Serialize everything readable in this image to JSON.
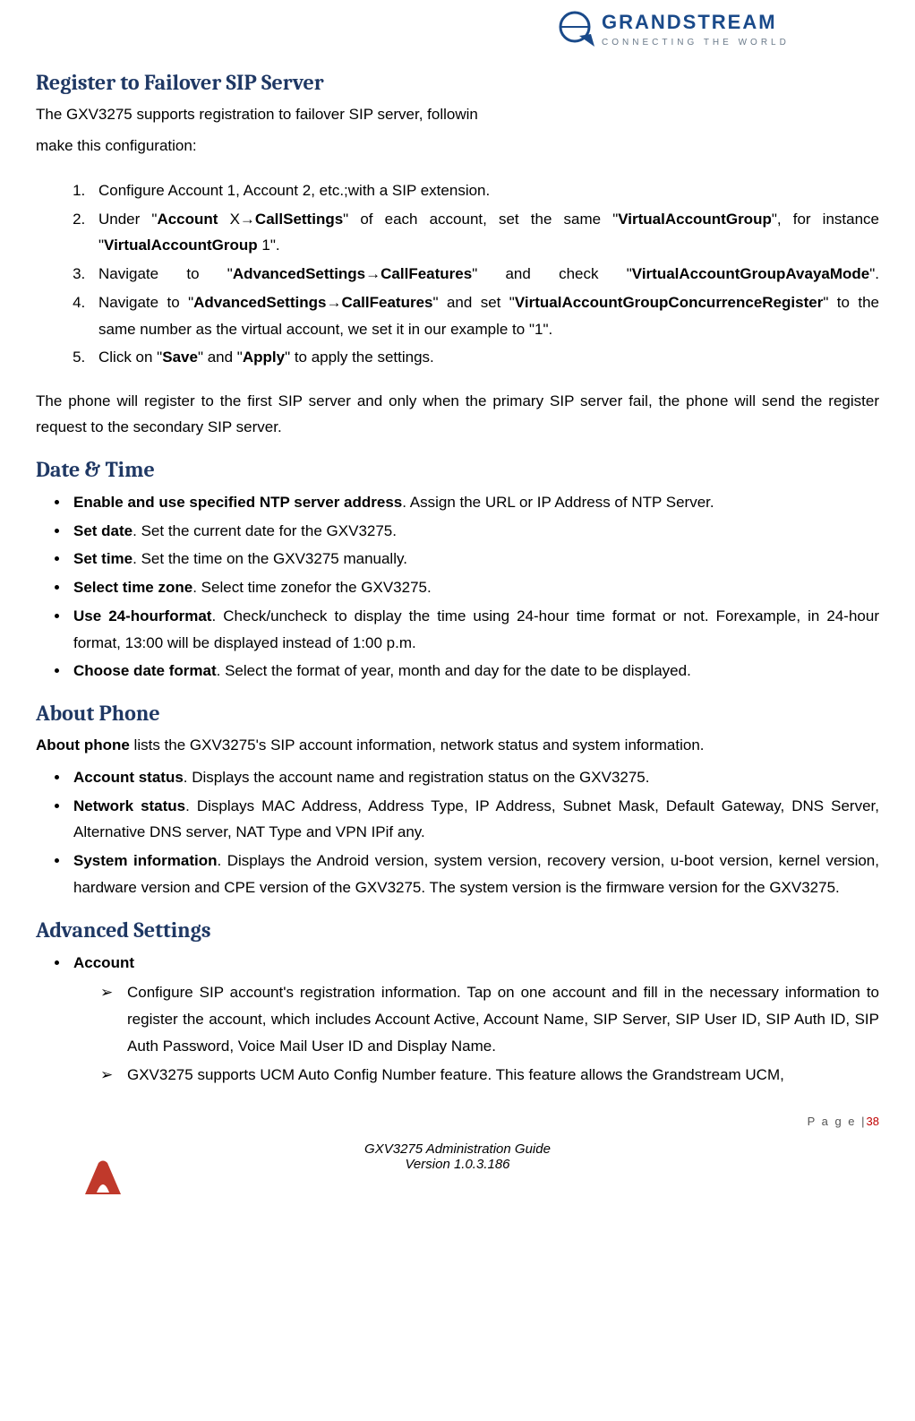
{
  "logo": {
    "brand": "GRANDSTREAM",
    "tagline": "CONNECTING THE WORLD"
  },
  "s1": {
    "heading": "Register to Failover SIP Server",
    "intro_a": "The GXV3275 supports registration to failover SIP server, followin",
    "intro_b": "make this configuration:",
    "step1": "Configure Account 1, Account 2, etc.;with a SIP extension.",
    "step2_a": "Under \"",
    "step2_b": "Account",
    "step2_c": " X",
    "step2_arrow": "→",
    "step2_d": "CallSettings",
    "step2_e": "\" of each account, set the same \"",
    "step2_f": "VirtualAccountGroup",
    "step2_g": "\", for instance \"",
    "step2_h": "VirtualAccountGroup",
    "step2_i": " 1\".",
    "step3_a": "Navigate to \"",
    "step3_b": "AdvancedSettings",
    "step3_arrow": "→",
    "step3_c": "CallFeatures",
    "step3_d": "\" and check \"",
    "step3_e": "VirtualAccountGroupAvayaMode",
    "step3_f": "\".",
    "step4_a": "Navigate to \"",
    "step4_b": "AdvancedSettings",
    "step4_arrow": "→",
    "step4_c": "CallFeatures",
    "step4_d": "\" and set \"",
    "step4_e": "VirtualAccountGroupConcurrenceRegister",
    "step4_f": "\" to the same number as the virtual account, we set it in our example to \"1\".",
    "step5_a": "Click on \"",
    "step5_b": "Save",
    "step5_c": "\" and \"",
    "step5_d": "Apply",
    "step5_e": "\" to apply the settings.",
    "outro": "The phone will register to the first SIP server and only when the primary SIP server fail, the phone will send the register request to the secondary SIP server."
  },
  "s2": {
    "heading": "Date & Time",
    "i1_b": "Enable and use specified NTP server address",
    "i1_t": ". Assign the URL or IP Address of NTP Server.",
    "i2_b": "Set date",
    "i2_t": ". Set the current date for the GXV3275.",
    "i3_b": "Set time",
    "i3_t": ". Set the time on the GXV3275 manually.",
    "i4_b": "Select time zone",
    "i4_t": ". Select time zonefor the GXV3275.",
    "i5_b": "Use 24-hourformat",
    "i5_t": ". Check/uncheck to display the time using 24-hour time format or not. Forexample, in 24-hour format, 13:00 will be displayed instead of 1:00 p.m.",
    "i6_b": "Choose date format",
    "i6_t": ". Select the format of year, month and day for the date to be displayed."
  },
  "s3": {
    "heading": "About Phone",
    "intro_b": "About phone",
    "intro_t": " lists the GXV3275's SIP account information, network status and system information.",
    "i1_b": "Account status",
    "i1_t": ". Displays the account name and registration status on the GXV3275.",
    "i2_b": "Network status",
    "i2_t": ". Displays MAC Address, Address Type, IP Address, Subnet Mask, Default Gateway, DNS Server, Alternative DNS server, NAT Type and VPN IPif any.",
    "i3_b": "System information",
    "i3_t": ". Displays the Android version, system version, recovery version, u-boot version, kernel version, hardware version and CPE version of the GXV3275. The system version is the firmware version for the GXV3275."
  },
  "s4": {
    "heading": "Advanced Settings",
    "i1_b": "Account",
    "a1": "Configure SIP account's registration information. Tap on one account and fill in the necessary information to register the account, which includes Account Active, Account Name, SIP Server, SIP User ID, SIP Auth ID, SIP Auth Password, Voice Mail User ID and Display Name.",
    "a2": "GXV3275 supports UCM Auto Config Number feature. This feature allows the Grandstream UCM,"
  },
  "footer": {
    "page_label": "P a g e  |",
    "page_num": "38",
    "line1": "GXV3275 Administration Guide",
    "line2": "Version 1.0.3.186"
  }
}
